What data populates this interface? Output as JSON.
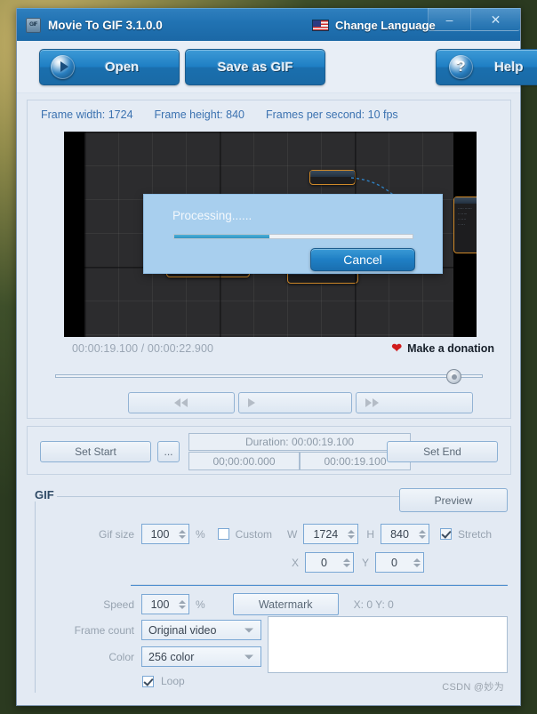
{
  "window": {
    "title": "Movie To GIF 3.1.0.0",
    "app_icon": "gif-app-icon",
    "language_button": "Change Language",
    "language_flag": "us-flag-icon",
    "minimize": "–",
    "close": "✕"
  },
  "toolbar": {
    "open": "Open",
    "save_as_gif": "Save as GIF",
    "help": "Help",
    "open_icon": "play-circle-icon",
    "help_icon": "question-circle-icon"
  },
  "video_info": {
    "frame_width": "Frame width: 1724",
    "frame_height": "Frame height: 840",
    "fps": "Frames per second: 10 fps"
  },
  "player": {
    "timecode": "00:00:19.100 / 00:00:22.900",
    "donation": "Make a donation",
    "donation_icon": "heart-icon",
    "rewind_icon": "rewind-icon",
    "play_icon": "play-icon",
    "forward_icon": "fast-forward-icon"
  },
  "trim": {
    "set_start": "Set Start",
    "set_end": "Set End",
    "browse_start": "...",
    "browse_end": "...",
    "duration": "Duration: 00:00:19.100",
    "start_time": "00;00:00.000",
    "end_time": "00:00:19.100"
  },
  "gif": {
    "legend": "GIF",
    "preview": "Preview",
    "gif_size_label": "Gif size",
    "gif_size_value": "100",
    "percent": "%",
    "custom_label": "Custom",
    "custom_checked": false,
    "w_label": "W",
    "w_value": "1724",
    "h_label": "H",
    "h_value": "840",
    "stretch_label": "Stretch",
    "stretch_checked": true,
    "x_label": "X",
    "x_value": "0",
    "y_label": "Y",
    "y_value": "0",
    "speed_label": "Speed",
    "speed_value": "100",
    "frame_count_label": "Frame count",
    "frame_count_value": "Original video",
    "color_label": "Color",
    "color_value": "256 color",
    "loop_label": "Loop",
    "loop_checked": true,
    "watermark_button": "Watermark",
    "watermark_xy": "X: 0  Y: 0"
  },
  "dialog": {
    "message": "Processing......",
    "cancel": "Cancel",
    "progress_percent": 40
  },
  "watermark_credit": "CSDN @妙为",
  "colors": {
    "titlebar": "#2173b3",
    "button_blue": "#1f7fc4",
    "panel_bg": "#e4ebf4",
    "window_bg": "#e3eaf3",
    "link_blue": "#3b72b0",
    "dialog_bg": "#a8cfee",
    "progress_fill": "#2e93c2",
    "heart_red": "#d01c1c"
  }
}
